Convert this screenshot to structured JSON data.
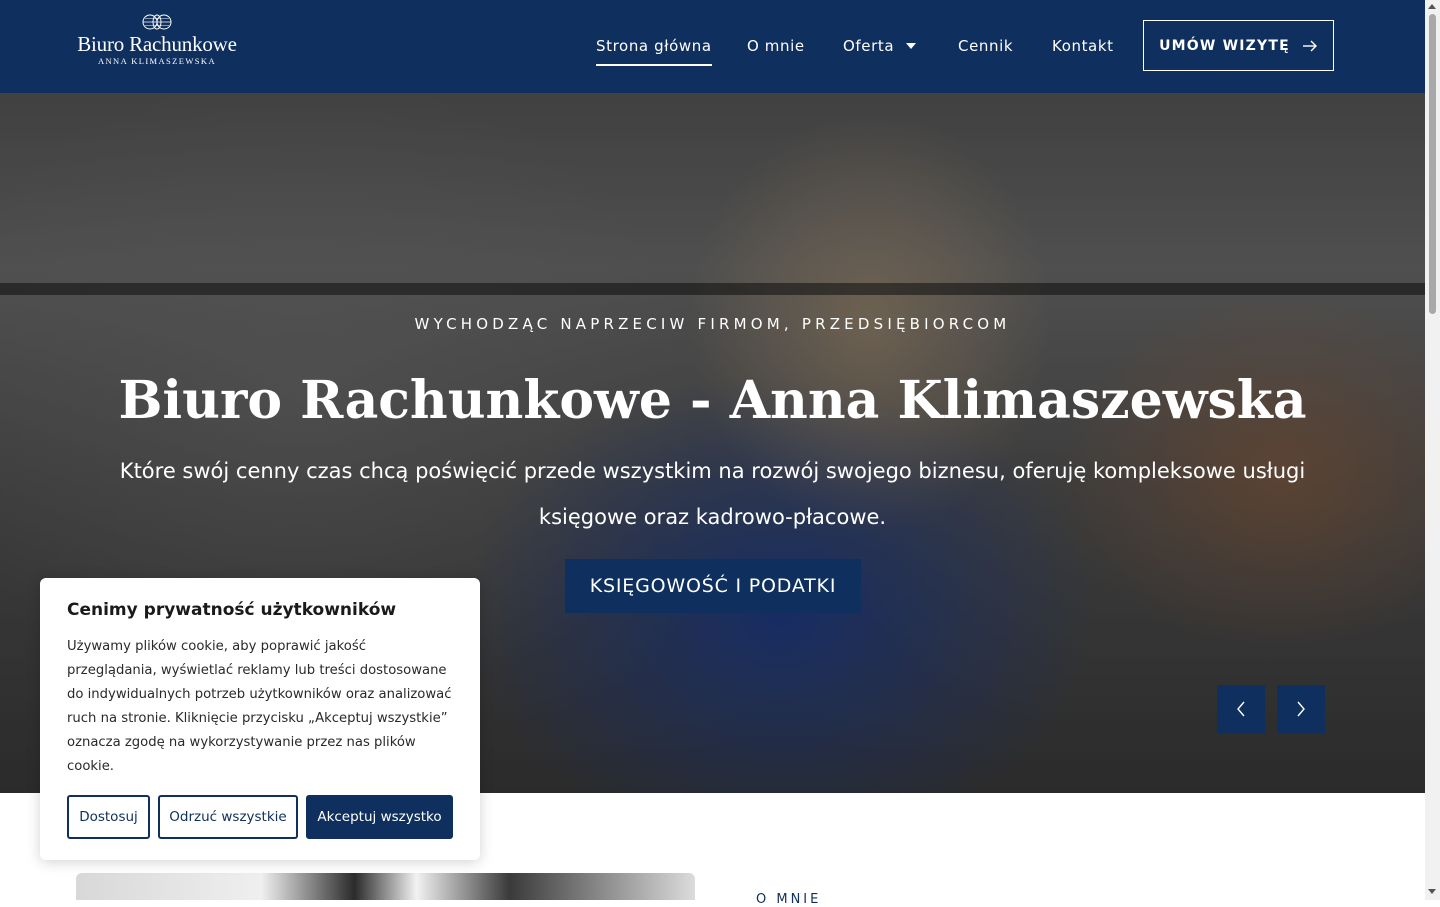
{
  "colors": {
    "brand": "#0f2f5e",
    "text_light": "#ffffff"
  },
  "logo": {
    "title": "Biuro Rachunkowe",
    "subtitle": "ANNA KLIMASZEWSKA"
  },
  "nav": {
    "items": [
      {
        "label": "Strona główna",
        "active": true
      },
      {
        "label": "O mnie"
      },
      {
        "label": "Oferta",
        "has_dropdown": true
      },
      {
        "label": "Cennik"
      },
      {
        "label": "Kontakt"
      }
    ],
    "cta_label": "UMÓW WIZYTĘ",
    "cta_icon": "arrow-right-icon"
  },
  "hero": {
    "eyebrow": "WYCHODZĄC NAPRZECIW FIRMOM, PRZEDSIĘBIORCOM",
    "title": "Biuro Rachunkowe - Anna Klimaszewska",
    "text": "Które swój cenny czas chcą poświęcić przede wszystkim na rozwój swojego biznesu, oferuję kompleksowe usługi księgowe oraz kadrowo-płacowe.",
    "button_label": "KSIĘGOWOŚĆ I PODATKI",
    "prev_icon": "chevron-left-icon",
    "next_icon": "chevron-right-icon"
  },
  "about": {
    "label": "O MNIE"
  },
  "cookie": {
    "title": "Cenimy prywatność użytkowników",
    "body": "Używamy plików cookie, aby poprawić jakość przeglądania, wyświetlać reklamy lub treści dostosowane do indywidualnych potrzeb użytkowników oraz analizować ruch na stronie. Kliknięcie przycisku „Akceptuj wszystkie” oznacza zgodę na wykorzystywanie przez nas plików cookie.",
    "customize_label": "Dostosuj",
    "reject_label": "Odrzuć wszystkie",
    "accept_label": "Akceptuj wszystko"
  }
}
